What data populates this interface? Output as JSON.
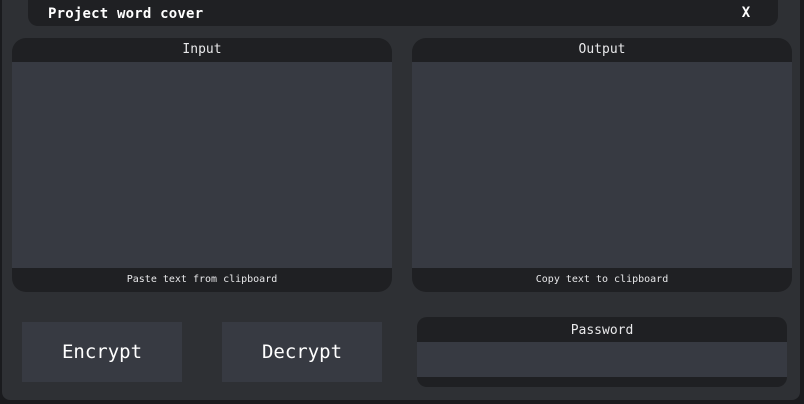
{
  "window": {
    "title": "Project word cover",
    "close_label": "X"
  },
  "input_panel": {
    "header": "Input",
    "value": "",
    "footer": "Paste text from clipboard"
  },
  "output_panel": {
    "header": "Output",
    "value": "",
    "footer": "Copy text to clipboard"
  },
  "actions": {
    "encrypt_label": "Encrypt",
    "decrypt_label": "Decrypt"
  },
  "password": {
    "header": "Password",
    "value": ""
  },
  "colors": {
    "background": "#2e3034",
    "panel_frame": "#1f2023",
    "field": "#373a42",
    "text": "#ffffff"
  }
}
